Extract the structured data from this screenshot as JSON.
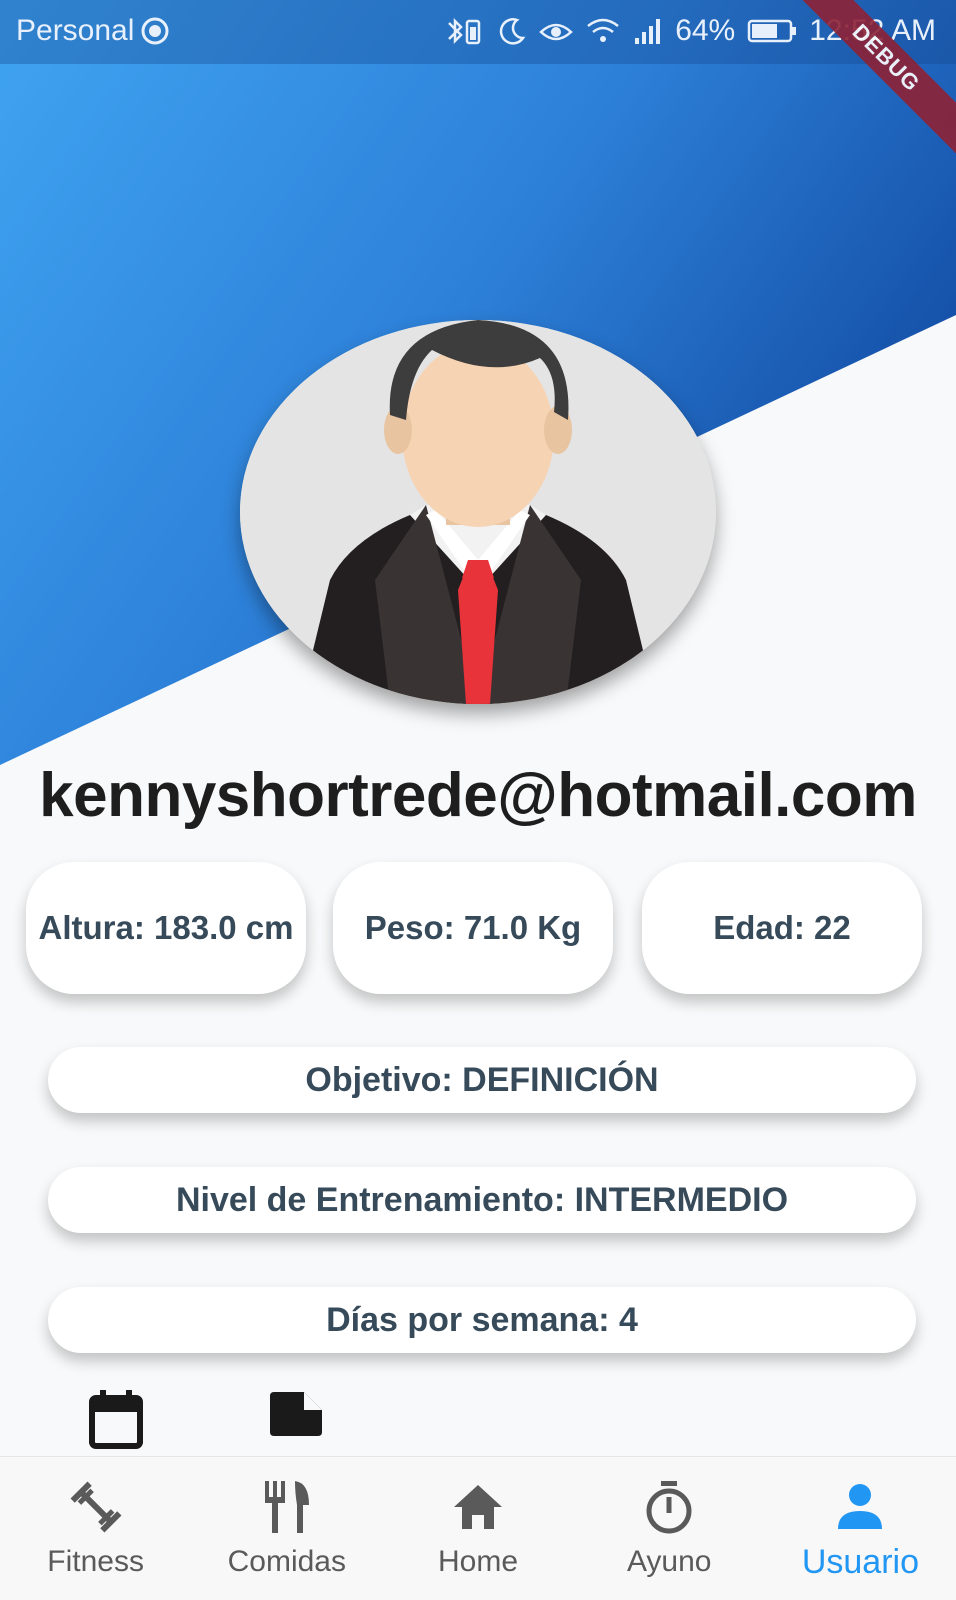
{
  "status_bar": {
    "profile": "Personal",
    "battery": "64%",
    "time": "12:52 AM",
    "debug_label": "DEBUG"
  },
  "profile": {
    "email": "kennyshortrede@hotmail.com",
    "stats": {
      "height": "Altura: 183.0 cm",
      "weight": "Peso: 71.0 Kg",
      "age": "Edad: 22"
    },
    "goal": "Objetivo: DEFINICIÓN",
    "training_level": "Nivel de Entrenamiento: INTERMEDIO",
    "days_per_week": "Días por semana: 4"
  },
  "actions": [
    "calendar-icon",
    "note-icon"
  ],
  "bottom_nav": {
    "items": [
      {
        "label": "Fitness",
        "icon": "dumbbell-icon"
      },
      {
        "label": "Comidas",
        "icon": "restaurant-icon"
      },
      {
        "label": "Home",
        "icon": "home-icon"
      },
      {
        "label": "Ayuno",
        "icon": "timer-icon"
      },
      {
        "label": "Usuario",
        "icon": "person-icon"
      }
    ],
    "active_index": 4
  },
  "colors": {
    "accent": "#2196f3",
    "header_gradient_start": "#40a4f2",
    "header_gradient_end": "#0f47a0",
    "text_dark": "#364a5a"
  }
}
